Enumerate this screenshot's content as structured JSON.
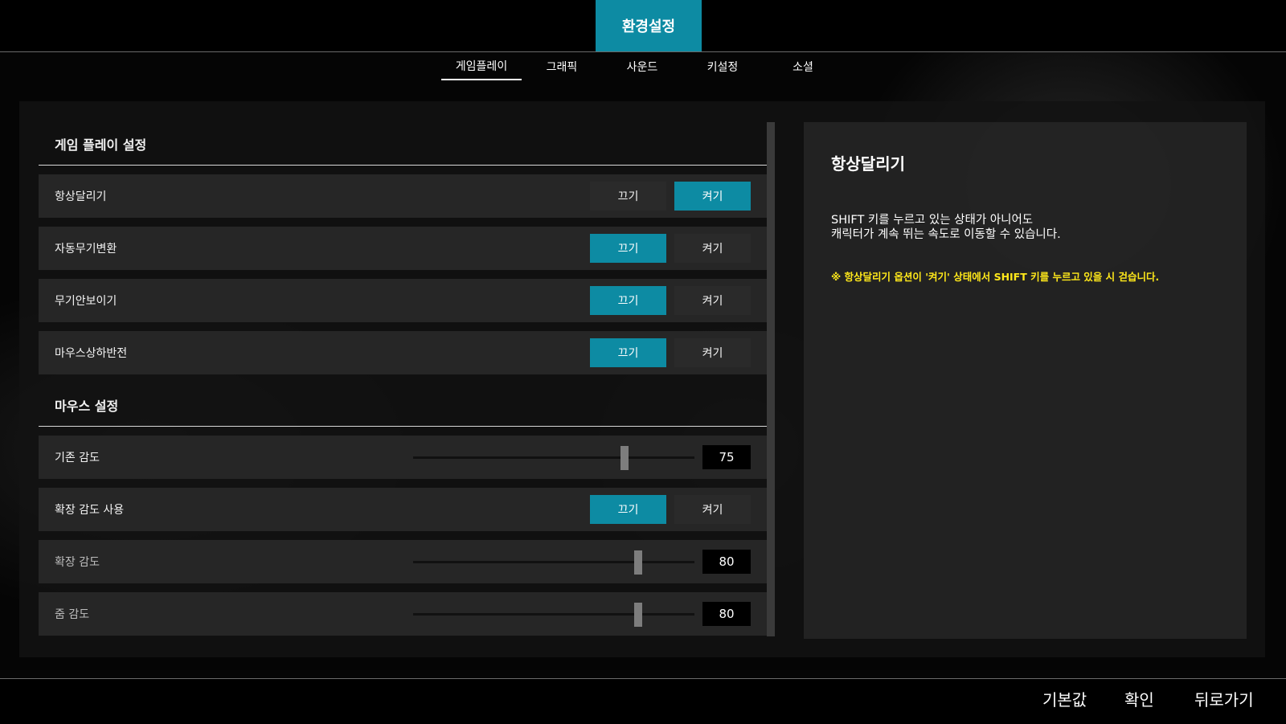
{
  "header": {
    "title": "환경설정",
    "tabs": [
      {
        "label": "게임플레이",
        "active": true
      },
      {
        "label": "그래픽",
        "active": false
      },
      {
        "label": "사운드",
        "active": false
      },
      {
        "label": "키설정",
        "active": false
      },
      {
        "label": "소셜",
        "active": false
      }
    ]
  },
  "sections": {
    "gameplay": {
      "title": "게임 플레이 설정",
      "rows": [
        {
          "label": "항상달리기",
          "off_label": "끄기",
          "on_label": "켜기",
          "value": "on"
        },
        {
          "label": "자동무기변환",
          "off_label": "끄기",
          "on_label": "켜기",
          "value": "off"
        },
        {
          "label": "무기안보이기",
          "off_label": "끄기",
          "on_label": "켜기",
          "value": "off"
        },
        {
          "label": "마우스상하반전",
          "off_label": "끄기",
          "on_label": "켜기",
          "value": "off"
        }
      ]
    },
    "mouse": {
      "title": "마우스 설정",
      "base_sensitivity": {
        "label": "기존 감도",
        "value": "75",
        "level": 75
      },
      "extended_toggle": {
        "label": "확장 감도 사용",
        "off_label": "끄기",
        "on_label": "켜기",
        "value": "off"
      },
      "extended_sensitivity": {
        "label": "확장 감도",
        "value": "80",
        "level": 80
      },
      "zoom_sensitivity": {
        "label": "줌 감도",
        "value": "80",
        "level": 80
      }
    }
  },
  "description": {
    "title": "항상달리기",
    "line1": "SHIFT 키를 누르고 있는 상태가 아니어도",
    "line2": "캐릭터가 계속 뛰는 속도로 이동할 수 있습니다.",
    "warning": "※ 항상달리기 옵션이 '켜기' 상태에서 SHIFT 키를 누르고 있을 시 걷습니다.",
    "warning_color": "#ffe81a"
  },
  "footer": {
    "default_label": "기본값",
    "confirm_label": "확인",
    "back_label": "뒤로가기"
  },
  "colors": {
    "accent": "#0d8ba3"
  }
}
